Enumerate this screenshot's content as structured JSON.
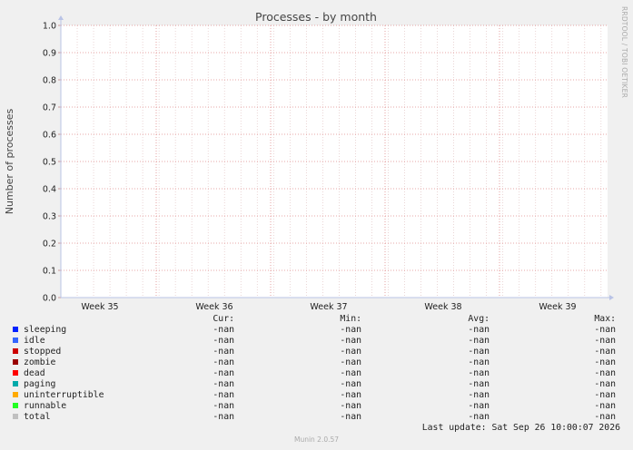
{
  "chart_data": {
    "type": "line",
    "title": "Processes - by month",
    "ylabel": "Number of processes",
    "xlabel": "",
    "side_label": "RRDTOOL / TOBI OETIKER",
    "ylim": [
      0,
      1.0
    ],
    "y_ticks": [
      "0.0",
      "0.1",
      "0.2",
      "0.3",
      "0.4",
      "0.5",
      "0.6",
      "0.7",
      "0.8",
      "0.9",
      "1.0"
    ],
    "x_ticks": [
      "Week 35",
      "Week 36",
      "Week 37",
      "Week 38",
      "Week 39"
    ],
    "grid": true,
    "series": [
      {
        "name": "sleeping",
        "color": "#0022ff",
        "values": []
      },
      {
        "name": "idle",
        "color": "#3366ff",
        "values": []
      },
      {
        "name": "stopped",
        "color": "#cc0000",
        "values": []
      },
      {
        "name": "zombie",
        "color": "#990000",
        "values": []
      },
      {
        "name": "dead",
        "color": "#ff0000",
        "values": []
      },
      {
        "name": "paging",
        "color": "#00aaaa",
        "values": []
      },
      {
        "name": "uninterruptible",
        "color": "#ffaa00",
        "values": []
      },
      {
        "name": "runnable",
        "color": "#22ff22",
        "values": []
      },
      {
        "name": "total",
        "color": "#c0c0c0",
        "values": []
      }
    ]
  },
  "legend": {
    "headers": {
      "cur": "Cur:",
      "min": "Min:",
      "avg": "Avg:",
      "max": "Max:"
    },
    "rows": [
      {
        "name": "sleeping",
        "cur": "-nan",
        "min": "-nan",
        "avg": "-nan",
        "max": "-nan"
      },
      {
        "name": "idle",
        "cur": "-nan",
        "min": "-nan",
        "avg": "-nan",
        "max": "-nan"
      },
      {
        "name": "stopped",
        "cur": "-nan",
        "min": "-nan",
        "avg": "-nan",
        "max": "-nan"
      },
      {
        "name": "zombie",
        "cur": "-nan",
        "min": "-nan",
        "avg": "-nan",
        "max": "-nan"
      },
      {
        "name": "dead",
        "cur": "-nan",
        "min": "-nan",
        "avg": "-nan",
        "max": "-nan"
      },
      {
        "name": "paging",
        "cur": "-nan",
        "min": "-nan",
        "avg": "-nan",
        "max": "-nan"
      },
      {
        "name": "uninterruptible",
        "cur": "-nan",
        "min": "-nan",
        "avg": "-nan",
        "max": "-nan"
      },
      {
        "name": "runnable",
        "cur": "-nan",
        "min": "-nan",
        "avg": "-nan",
        "max": "-nan"
      },
      {
        "name": "total",
        "cur": "-nan",
        "min": "-nan",
        "avg": "-nan",
        "max": "-nan"
      }
    ]
  },
  "last_update": "Last update: Sat Sep 26 10:00:07 2026",
  "footer": "Munin 2.0.57"
}
